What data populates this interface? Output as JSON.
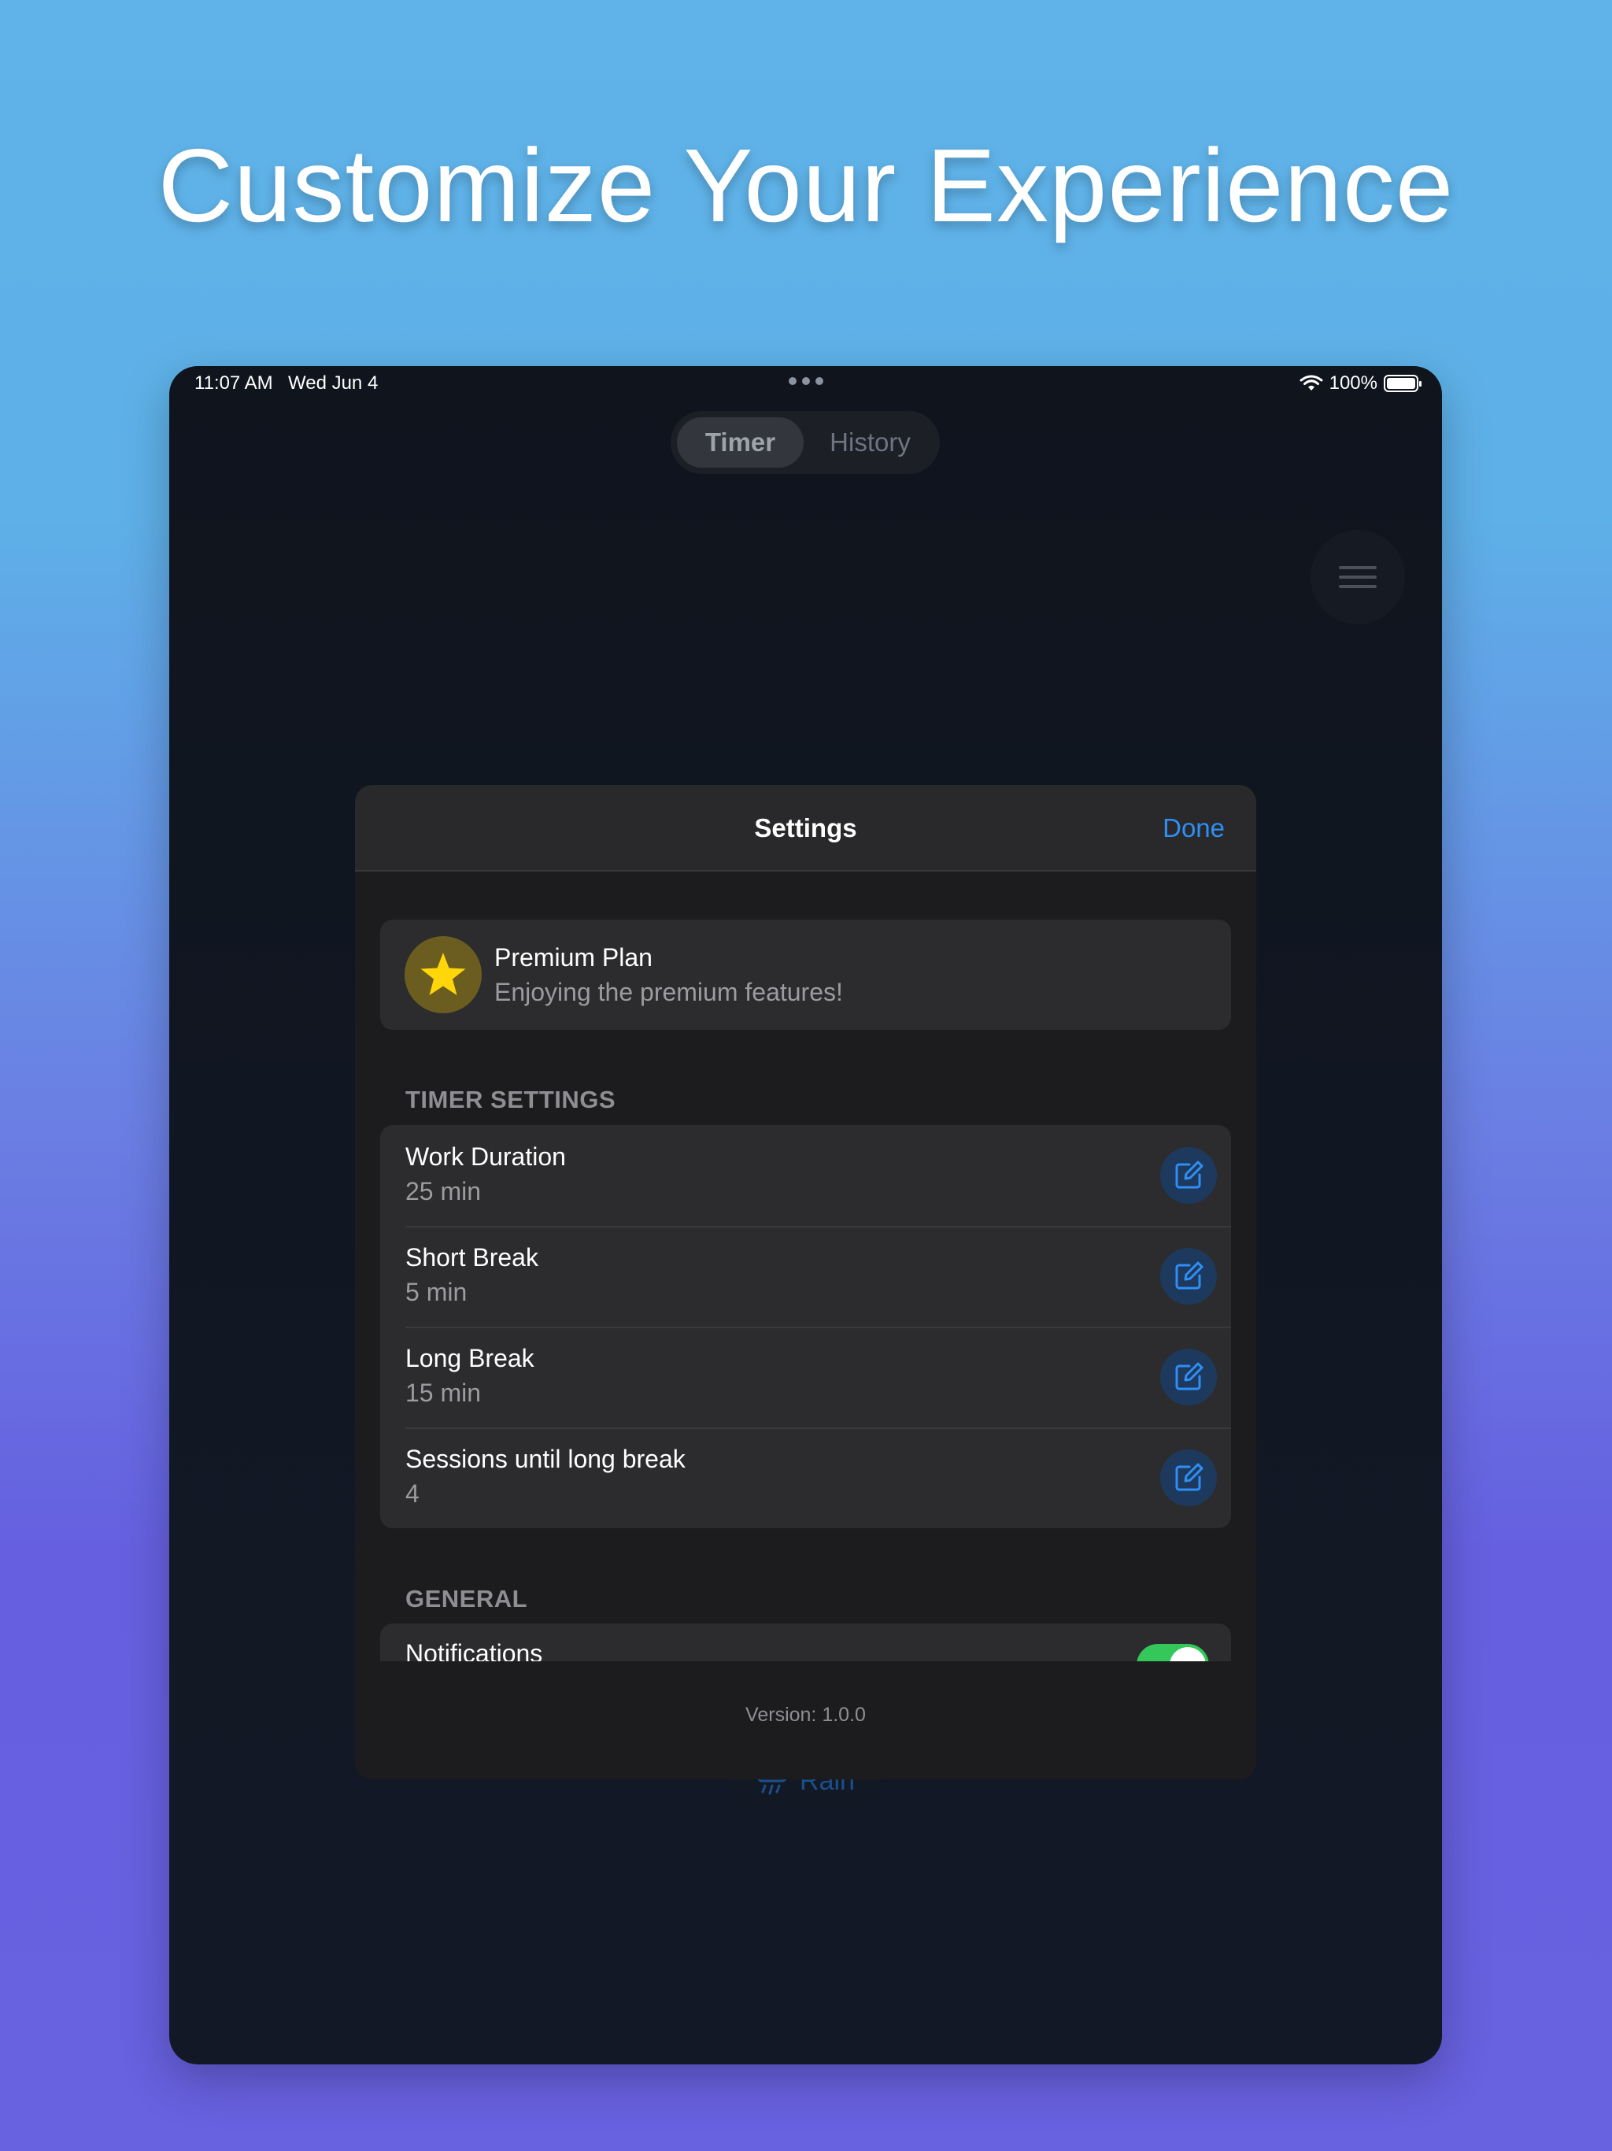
{
  "headline": "Customize Your Experience",
  "status_bar": {
    "time": "11:07 AM",
    "date": "Wed Jun 4",
    "battery": "100%"
  },
  "segmented_control": {
    "tabs": [
      {
        "label": "Timer",
        "selected": true
      },
      {
        "label": "History",
        "selected": false
      }
    ]
  },
  "background": {
    "sound_pill_label": "Rain"
  },
  "settings_sheet": {
    "title": "Settings",
    "done_label": "Done",
    "premium": {
      "title": "Premium Plan",
      "subtitle": "Enjoying the premium features!",
      "icon": "star-icon"
    },
    "timer_settings": {
      "header": "TIMER SETTINGS",
      "rows": [
        {
          "label": "Work Duration",
          "value": "25 min"
        },
        {
          "label": "Short Break",
          "value": "5 min"
        },
        {
          "label": "Long Break",
          "value": "15 min"
        },
        {
          "label": "Sessions until long break",
          "value": "4"
        }
      ]
    },
    "general": {
      "header": "GENERAL",
      "rows": [
        {
          "label": "Notifications",
          "toggle_on": true
        }
      ]
    },
    "version": "Version: 1.0.0"
  },
  "colors": {
    "accent": "#2f8ff5",
    "toggle_on": "#34c759",
    "star": "#ffd60a"
  }
}
